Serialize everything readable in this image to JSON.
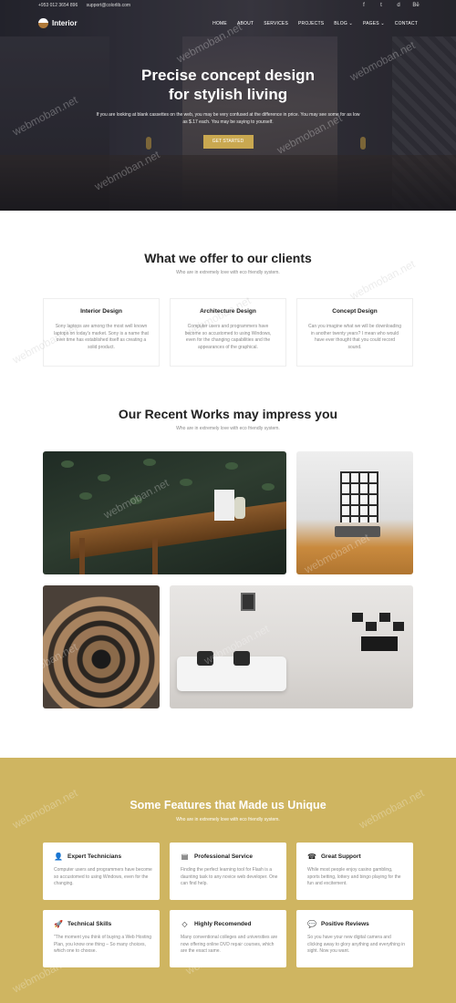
{
  "topbar": {
    "phone": "+953 012 3654 896",
    "email": "support@colorlib.com",
    "social": [
      "facebook-icon",
      "twitter-icon",
      "dribbble-icon",
      "behance-icon"
    ],
    "social_glyphs": [
      "f",
      "t",
      "d",
      "Bē"
    ]
  },
  "nav": {
    "brand": "Interior",
    "items": [
      "HOME",
      "ABOUT",
      "SERVICES",
      "PROJECTS",
      "BLOG ⌄",
      "PAGES ⌄",
      "CONTACT"
    ]
  },
  "hero": {
    "title_line1": "Precise concept design",
    "title_line2": "for stylish living",
    "description": "If you are looking at blank cassettes on the web, you may be very confused at the difference in price. You may see some for as low as $.17 each. You may be saying to yourself.",
    "button": "GET STARTED"
  },
  "offer": {
    "title": "What we offer to our clients",
    "subtitle": "Who are in extremely love with eco friendly system.",
    "cards": [
      {
        "title": "Interior Design",
        "text": "Sony laptops are among the most well known laptops on today's market. Sony is a name that over time has established itself as creating a solid product."
      },
      {
        "title": "Architecture Design",
        "text": "Computer users and programmers have become so accustomed to using Windows, even for the changing capabilities and the appearances of the graphical."
      },
      {
        "title": "Concept Design",
        "text": "Can you imagine what we will be downloading in another twenty years? I mean who would have ever thought that you could record sound."
      }
    ]
  },
  "works": {
    "title": "Our Recent Works may impress you",
    "subtitle": "Who are in extremely love with eco friendly system."
  },
  "features": {
    "title": "Some Features that Made us Unique",
    "subtitle": "Who are in extremely love with eco friendly system.",
    "cards": [
      {
        "icon": "user-icon",
        "glyph": "👤",
        "title": "Expert Technicians",
        "text": "Computer users and programmers have become so accustomed to using Windows, even for the changing."
      },
      {
        "icon": "license-icon",
        "glyph": "▤",
        "title": "Professional Service",
        "text": "Finding the perfect learning tool for Flash is a daunting task to any novice web developer. One can find help."
      },
      {
        "icon": "phone-icon",
        "glyph": "☎",
        "title": "Great Support",
        "text": "While most people enjoy casino gambling, sports betting, lottery and bingo playing for the fun and excitement."
      },
      {
        "icon": "rocket-icon",
        "glyph": "🚀",
        "title": "Technical Skills",
        "text": "\"The moment you think of buying a Web Hosting Plan, you know one thing – So many choices, which one to choose."
      },
      {
        "icon": "diamond-icon",
        "glyph": "◇",
        "title": "Highly Recomended",
        "text": "Many conventional colleges and universities are now offering online DVD repair courses, which are the exact same."
      },
      {
        "icon": "chat-icon",
        "glyph": "💬",
        "title": "Positive Reviews",
        "text": "So you have your new digital camera and clicking away to glory anything and everything in sight. Now you want."
      }
    ]
  },
  "watermark": "webmoban.net",
  "colors": {
    "accent": "#c9a850",
    "features_bg": "#cfb561"
  }
}
